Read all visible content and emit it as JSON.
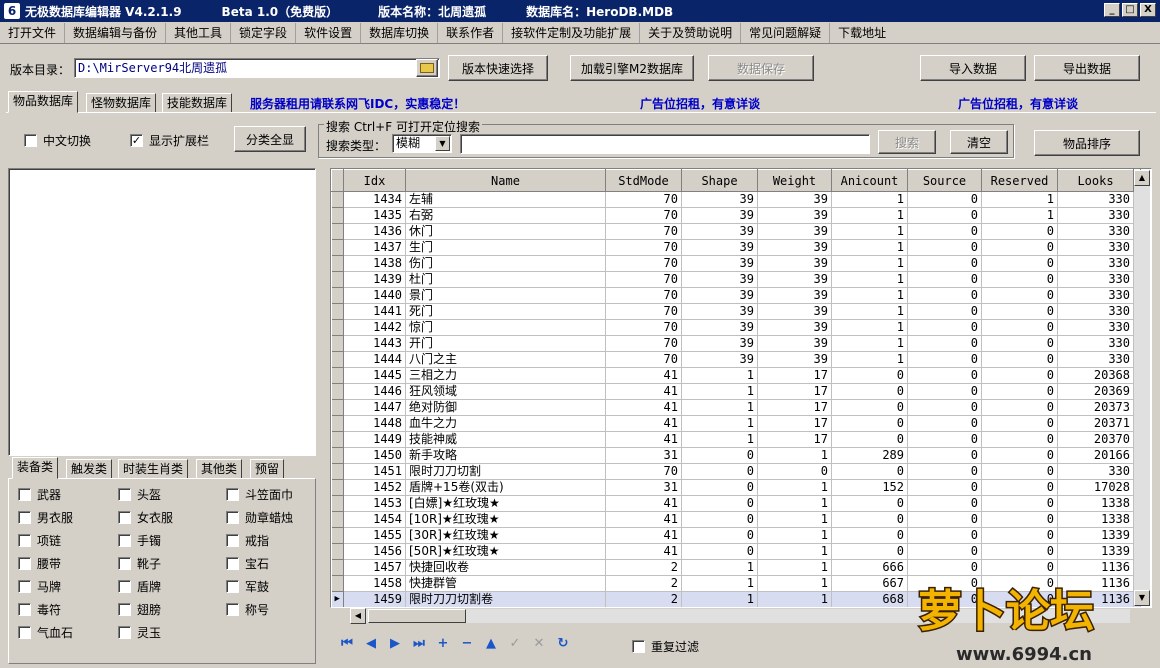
{
  "window": {
    "title": "无极数据库编辑器 V4.2.1.9",
    "beta": "Beta 1.0（免费版）",
    "version_name": "版本名称：北周遗孤",
    "db_name": "数据库名：HeroDB.MDB",
    "controls": [
      "_",
      "□",
      "X"
    ]
  },
  "menu": [
    "打开文件",
    "数据编辑与备份",
    "其他工具",
    "锁定字段",
    "软件设置",
    "数据库切换",
    "联系作者",
    "接软件定制及功能扩展",
    "关于及赞助说明",
    "常见问题解疑",
    "下载地址"
  ],
  "toolbar": {
    "dir_label": "版本目录：",
    "dir_value": "D:\\MirServer94北周遗孤",
    "quick_select": "版本快速选择",
    "load_engine": "加载引擎M2数据库",
    "save_data": "数据保存",
    "import": "导入数据",
    "export": "导出数据"
  },
  "tabs": [
    "物品数据库",
    "怪物数据库",
    "技能数据库"
  ],
  "ads": {
    "server": "服务器租用请联系网飞IDC，实惠稳定！",
    "ad1": "广告位招租，有意详谈",
    "ad2": "广告位招租，有意详谈"
  },
  "options": {
    "chinese_switch": "中文切换",
    "show_ext": "显示扩展栏",
    "show_ext_checked": "✓",
    "show_all": "分类全显"
  },
  "search": {
    "group_title": "搜索  Ctrl+F 可打开定位搜索",
    "type_label": "搜索类型：",
    "type_value": "模糊",
    "search_btn": "搜索",
    "clear_btn": "清空",
    "sort_btn": "物品排序"
  },
  "category_tabs": [
    "装备类",
    "触发类",
    "时装生肖类",
    "其他类",
    "预留"
  ],
  "categories": [
    [
      "武器",
      "头盔",
      "斗笠面巾"
    ],
    [
      "男衣服",
      "女衣服",
      "勋章蜡烛"
    ],
    [
      "项链",
      "手镯",
      "戒指"
    ],
    [
      "腰带",
      "靴子",
      "宝石"
    ],
    [
      "马牌",
      "盾牌",
      "军鼓"
    ],
    [
      "毒符",
      "翅膀",
      "称号"
    ],
    [
      "气血石",
      "灵玉",
      ""
    ]
  ],
  "grid": {
    "columns": [
      "Idx",
      "Name",
      "StdMode",
      "Shape",
      "Weight",
      "Anicount",
      "Source",
      "Reserved",
      "Looks"
    ],
    "rows": [
      [
        "1434",
        "左辅",
        "70",
        "39",
        "39",
        "1",
        "0",
        "1",
        "330"
      ],
      [
        "1435",
        "右弼",
        "70",
        "39",
        "39",
        "1",
        "0",
        "1",
        "330"
      ],
      [
        "1436",
        "休门",
        "70",
        "39",
        "39",
        "1",
        "0",
        "0",
        "330"
      ],
      [
        "1437",
        "生门",
        "70",
        "39",
        "39",
        "1",
        "0",
        "0",
        "330"
      ],
      [
        "1438",
        "伤门",
        "70",
        "39",
        "39",
        "1",
        "0",
        "0",
        "330"
      ],
      [
        "1439",
        "杜门",
        "70",
        "39",
        "39",
        "1",
        "0",
        "0",
        "330"
      ],
      [
        "1440",
        "景门",
        "70",
        "39",
        "39",
        "1",
        "0",
        "0",
        "330"
      ],
      [
        "1441",
        "死门",
        "70",
        "39",
        "39",
        "1",
        "0",
        "0",
        "330"
      ],
      [
        "1442",
        "惊门",
        "70",
        "39",
        "39",
        "1",
        "0",
        "0",
        "330"
      ],
      [
        "1443",
        "开门",
        "70",
        "39",
        "39",
        "1",
        "0",
        "0",
        "330"
      ],
      [
        "1444",
        "八门之主",
        "70",
        "39",
        "39",
        "1",
        "0",
        "0",
        "330"
      ],
      [
        "1445",
        "三相之力",
        "41",
        "1",
        "17",
        "0",
        "0",
        "0",
        "20368"
      ],
      [
        "1446",
        "狂风领域",
        "41",
        "1",
        "17",
        "0",
        "0",
        "0",
        "20369"
      ],
      [
        "1447",
        "绝对防御",
        "41",
        "1",
        "17",
        "0",
        "0",
        "0",
        "20373"
      ],
      [
        "1448",
        "血牛之力",
        "41",
        "1",
        "17",
        "0",
        "0",
        "0",
        "20371"
      ],
      [
        "1449",
        "技能神威",
        "41",
        "1",
        "17",
        "0",
        "0",
        "0",
        "20370"
      ],
      [
        "1450",
        "新手攻略",
        "31",
        "0",
        "1",
        "289",
        "0",
        "0",
        "20166"
      ],
      [
        "1451",
        "限时刀刀切割",
        "70",
        "0",
        "0",
        "0",
        "0",
        "0",
        "330"
      ],
      [
        "1452",
        "盾牌+15卷(双击)",
        "31",
        "0",
        "1",
        "152",
        "0",
        "0",
        "17028"
      ],
      [
        "1453",
        "[白嫖]★红玫瑰★",
        "41",
        "0",
        "1",
        "0",
        "0",
        "0",
        "1338"
      ],
      [
        "1454",
        "[10R]★红玫瑰★",
        "41",
        "0",
        "1",
        "0",
        "0",
        "0",
        "1338"
      ],
      [
        "1455",
        "[30R]★红玫瑰★",
        "41",
        "0",
        "1",
        "0",
        "0",
        "0",
        "1339"
      ],
      [
        "1456",
        "[50R]★红玫瑰★",
        "41",
        "0",
        "1",
        "0",
        "0",
        "0",
        "1339"
      ],
      [
        "1457",
        "快捷回收卷",
        "2",
        "1",
        "1",
        "666",
        "0",
        "0",
        "1136"
      ],
      [
        "1458",
        "快捷群管",
        "2",
        "1",
        "1",
        "667",
        "0",
        "0",
        "1136"
      ],
      [
        "1459",
        "限时刀刀切割卷",
        "2",
        "1",
        "1",
        "668",
        "0",
        "0",
        "1136"
      ]
    ],
    "selected_row": 25
  },
  "nav": {
    "icons": [
      "first",
      "prior",
      "next",
      "last",
      "insert",
      "delete",
      "edit",
      "post",
      "cancel",
      "refresh"
    ],
    "dup_filter": "重复过滤"
  },
  "watermark": {
    "title": "萝卜论坛",
    "url": "www.6994.cn"
  }
}
